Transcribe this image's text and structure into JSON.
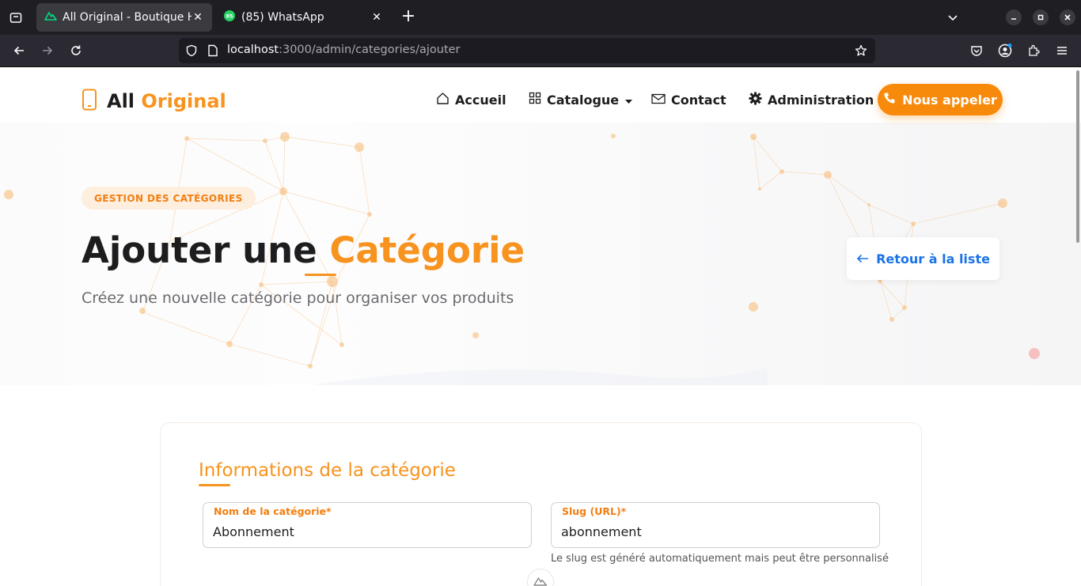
{
  "browser": {
    "tabs": [
      {
        "title": "All Original - Boutique High-Tech",
        "active": true,
        "icon": "nuxt-icon"
      },
      {
        "title": "(85) WhatsApp",
        "active": false,
        "icon": "whatsapp-icon",
        "badge": "85"
      }
    ],
    "url": {
      "host": "localhost",
      "rest": ":3000/admin/categories/ajouter"
    }
  },
  "site": {
    "logo": {
      "part1": "All",
      "part2": "Original"
    },
    "nav": {
      "home": "Accueil",
      "catalog": "Catalogue",
      "contact": "Contact",
      "admin": "Administration",
      "call": "Nous appeler"
    }
  },
  "hero": {
    "badge": "GESTION DES CATÉGORIES",
    "title_part1": "Ajouter une ",
    "title_part2": "Catégorie",
    "subtitle": "Créez une nouvelle catégorie pour organiser vos produits",
    "back_button": "Retour à la liste"
  },
  "form": {
    "title": "Informations de la catégorie",
    "name": {
      "label": "Nom de la catégorie*",
      "value": "Abonnement"
    },
    "slug": {
      "label": "Slug (URL)*",
      "value": "abonnement",
      "hint": "Le slug est généré automatiquement mais peut être personnalisé"
    }
  },
  "colors": {
    "accent": "#f7931e",
    "link": "#1a73e8",
    "chrome_dark": "#1f1f23"
  }
}
